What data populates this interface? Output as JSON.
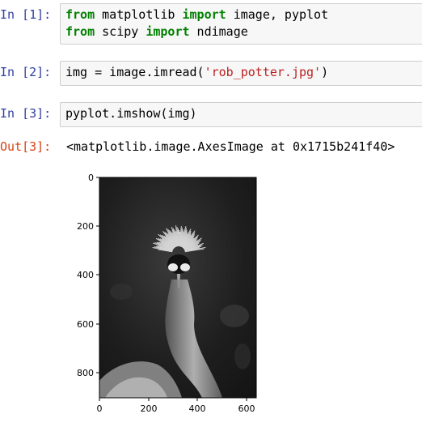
{
  "cells": [
    {
      "prompt": "In [1]:",
      "lines": [
        [
          {
            "t": "from",
            "k": "kw"
          },
          {
            "t": " matplotlib ",
            "k": ""
          },
          {
            "t": "import",
            "k": "kw"
          },
          {
            "t": " image, pyplot",
            "k": ""
          }
        ],
        [
          {
            "t": "from",
            "k": "kw"
          },
          {
            "t": " scipy ",
            "k": ""
          },
          {
            "t": "import",
            "k": "kw"
          },
          {
            "t": " ndimage",
            "k": ""
          }
        ]
      ]
    },
    {
      "prompt": "In [2]:",
      "lines": [
        [
          {
            "t": "img = image.imread(",
            "k": ""
          },
          {
            "t": "'rob_potter.jpg'",
            "k": "str"
          },
          {
            "t": ")",
            "k": ""
          }
        ]
      ]
    },
    {
      "prompt": "In [3]:",
      "lines": [
        [
          {
            "t": "pyplot.imshow(img)",
            "k": ""
          }
        ]
      ]
    }
  ],
  "output": {
    "prompt": "Out[3]:",
    "text": "<matplotlib.image.AxesImage at 0x1715b241f40>"
  },
  "plot": {
    "y_ticks": [
      "0",
      "200",
      "400",
      "600",
      "800"
    ],
    "x_ticks": [
      "0",
      "200",
      "400",
      "600"
    ],
    "image_description": "grayscale photo of a crowned crane"
  },
  "chart_data": {
    "type": "image",
    "x_ticks": [
      0,
      200,
      400,
      600
    ],
    "y_ticks": [
      0,
      200,
      400,
      600,
      800
    ],
    "xlim": [
      0,
      640
    ],
    "ylim": [
      914,
      0
    ]
  },
  "colors": {
    "in_prompt": "#303f9f",
    "out_prompt": "#d84315",
    "keyword": "#008000",
    "string": "#ba2121",
    "cell_bg": "#f7f7f7",
    "cell_border": "#cfcfcf"
  }
}
